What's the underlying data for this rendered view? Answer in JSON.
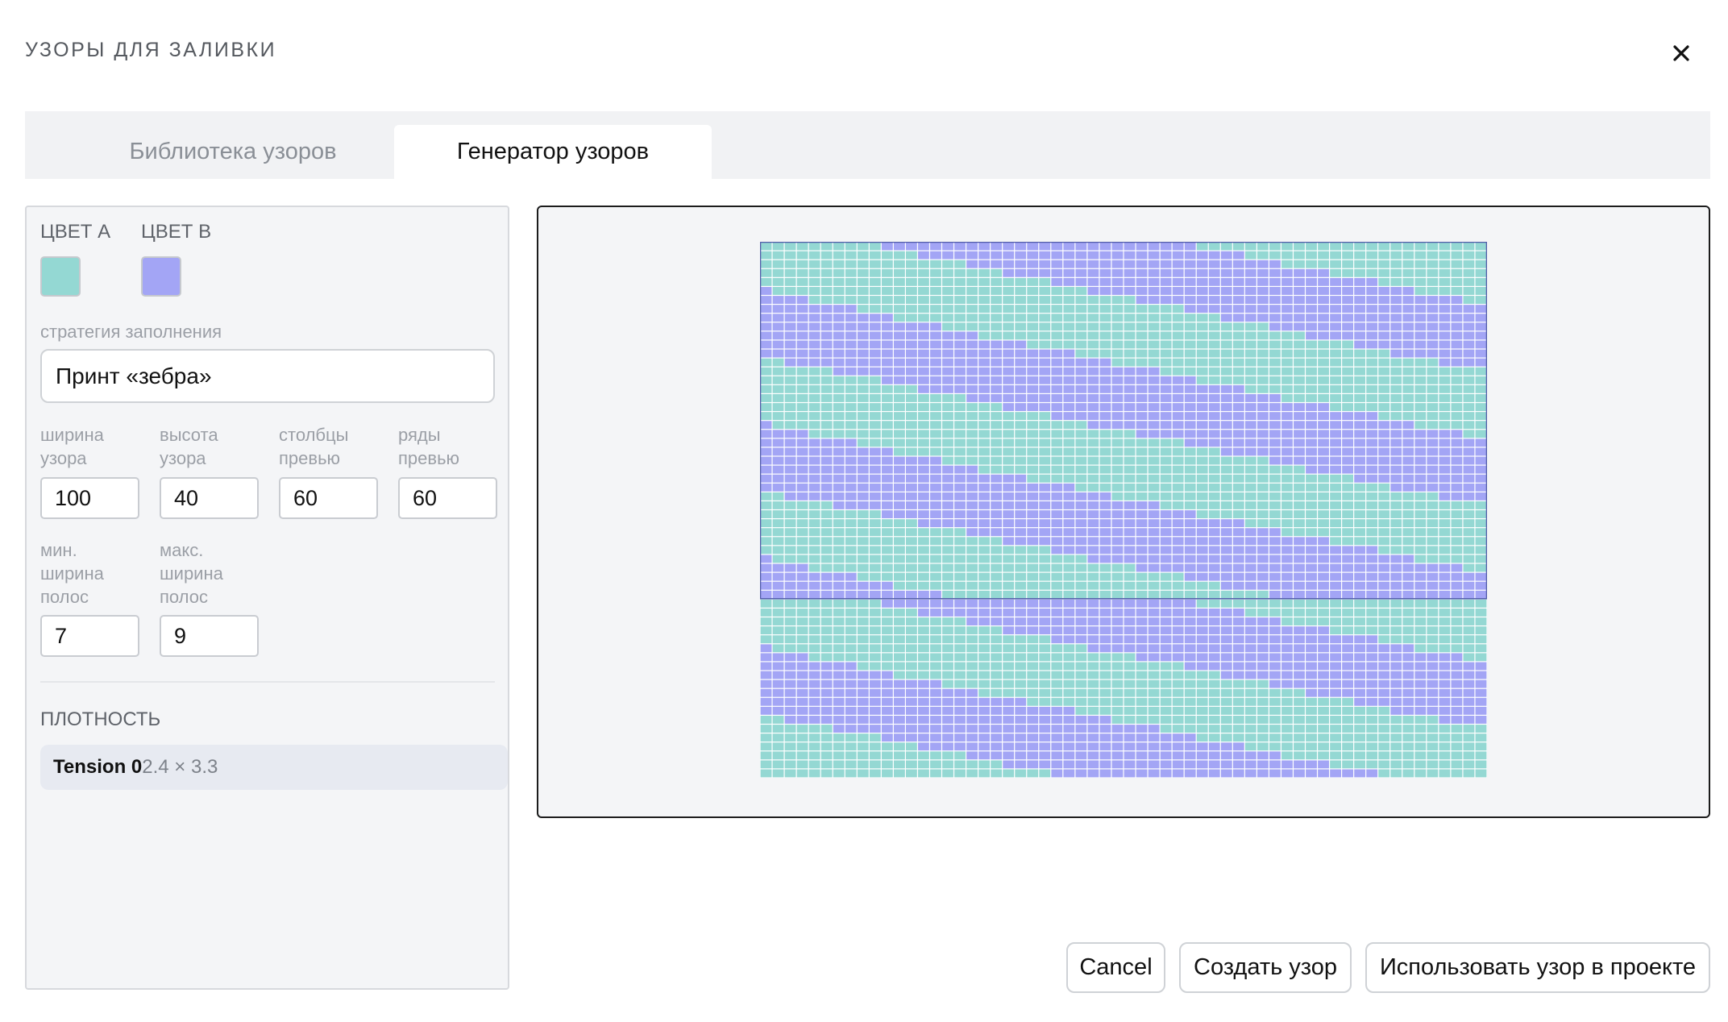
{
  "dialog": {
    "title": "УЗОРЫ ДЛЯ ЗАЛИВКИ"
  },
  "tabs": [
    {
      "label": "Библиотека узоров",
      "active": false
    },
    {
      "label": "Генератор узоров",
      "active": true
    }
  ],
  "sidebar": {
    "color_a": {
      "label": "ЦВЕТ A",
      "value": "#94d8d3"
    },
    "color_b": {
      "label": "ЦВЕТ B",
      "value": "#a3a5f5"
    },
    "strategy": {
      "label": "стратегия заполнения",
      "value": "Принт «зебра»"
    },
    "fields": [
      {
        "label_lines": [
          "ширина",
          "узора"
        ],
        "value": "100"
      },
      {
        "label_lines": [
          "высота",
          "узора"
        ],
        "value": "40"
      },
      {
        "label_lines": [
          "столбцы",
          "превью"
        ],
        "value": "60"
      },
      {
        "label_lines": [
          "ряды",
          "превью"
        ],
        "value": "60"
      }
    ],
    "stripe_fields": [
      {
        "label_lines": [
          "мин.",
          "ширина",
          "полос"
        ],
        "value": "7"
      },
      {
        "label_lines": [
          "макс.",
          "ширина",
          "полос"
        ],
        "value": "9"
      }
    ],
    "density": {
      "label": "ПЛОТНОСТЬ",
      "name": "Tension 0",
      "value": "2.4 × 3.3"
    }
  },
  "preview": {
    "columns": 60,
    "rows": 60,
    "pattern_columns": 60,
    "pattern_rows": 40,
    "colors": {
      "a": "#94d8d3",
      "b": "#a3a5f5",
      "grid_line": "#ffffff",
      "outline": "#4f5aa8"
    }
  },
  "footer": {
    "cancel": "Cancel",
    "create": "Создать узор",
    "use": "Использовать узор в проекте"
  }
}
